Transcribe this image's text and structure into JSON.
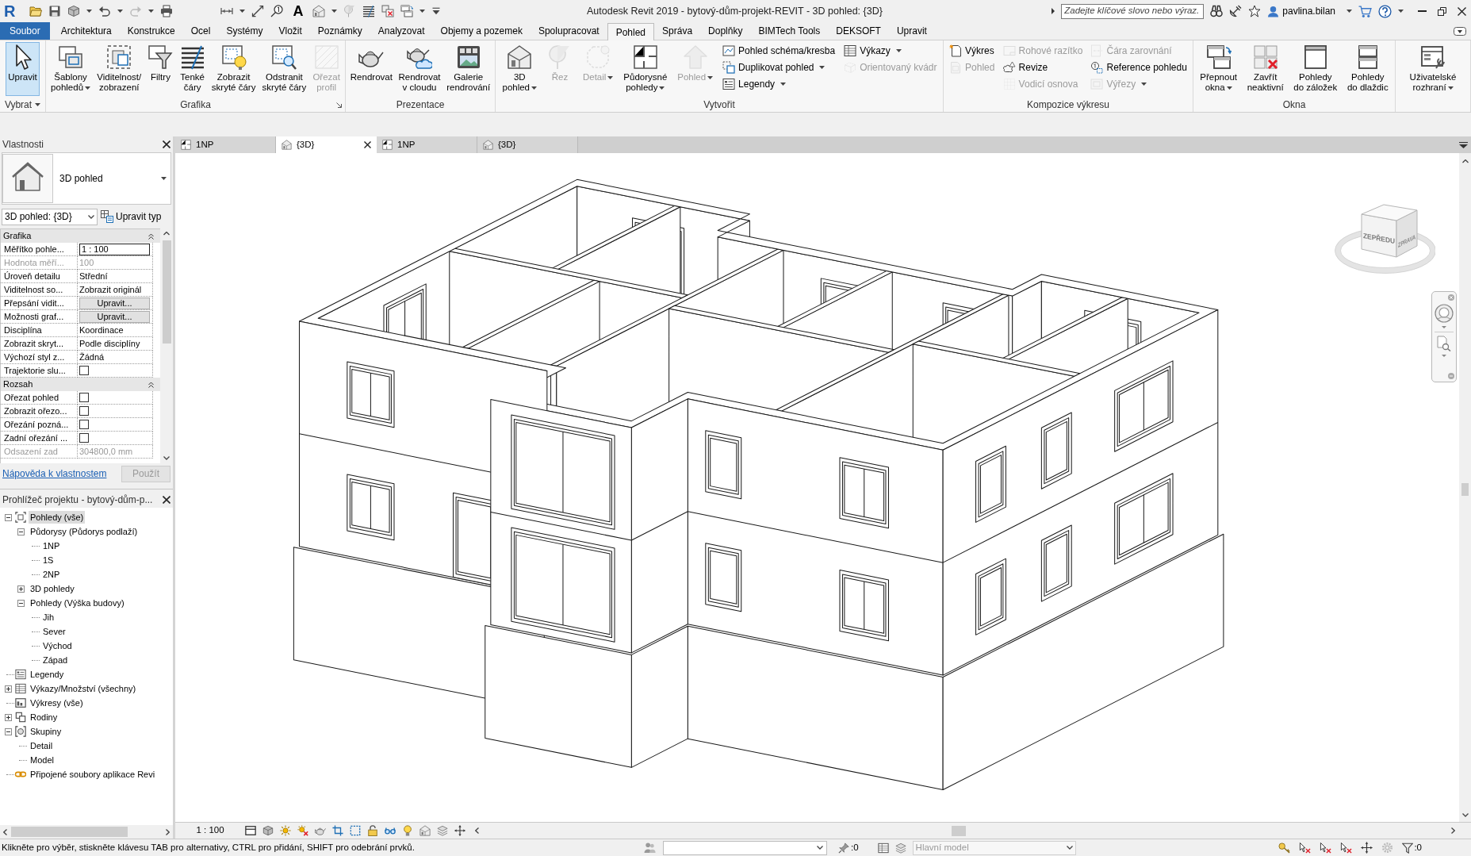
{
  "window": {
    "logo": "R",
    "title": "Autodesk Revit 2019 - bytový-dům-projekt-REVIT - 3D pohled: {3D}"
  },
  "quick_access": {
    "text_tool": "A"
  },
  "search": {
    "placeholder": "Zadejte klíčové slovo nebo výraz."
  },
  "user": {
    "name": "pavlina.bilan"
  },
  "ribbon_tabs": [
    {
      "label": "Soubor",
      "kind": "file",
      "selected": false
    },
    {
      "label": "Architektura",
      "kind": "tab",
      "selected": false
    },
    {
      "label": "Konstrukce",
      "kind": "tab",
      "selected": false
    },
    {
      "label": "Ocel",
      "kind": "tab",
      "selected": false
    },
    {
      "label": "Systémy",
      "kind": "tab",
      "selected": false
    },
    {
      "label": "Vložit",
      "kind": "tab",
      "selected": false
    },
    {
      "label": "Poznámky",
      "kind": "tab",
      "selected": false
    },
    {
      "label": "Analyzovat",
      "kind": "tab",
      "selected": false
    },
    {
      "label": "Objemy a pozemek",
      "kind": "tab",
      "selected": false
    },
    {
      "label": "Spolupracovat",
      "kind": "tab",
      "selected": false
    },
    {
      "label": "Pohled",
      "kind": "tab",
      "selected": true
    },
    {
      "label": "Správa",
      "kind": "tab",
      "selected": false
    },
    {
      "label": "Doplňky",
      "kind": "tab",
      "selected": false
    },
    {
      "label": "BIMTech Tools",
      "kind": "tab",
      "selected": false
    },
    {
      "label": "DEKSOFT",
      "kind": "tab",
      "selected": false
    },
    {
      "label": "Upravit",
      "kind": "tab",
      "selected": false
    }
  ],
  "ribbon_panels": [
    {
      "title": "Vybrat",
      "menu": true,
      "items": [
        {
          "kind": "large",
          "label": "Upravit",
          "active": true,
          "disabled": false
        }
      ]
    },
    {
      "title": "Grafika",
      "launcher": true,
      "items": [
        {
          "kind": "large",
          "label": "Šablony\npohledů",
          "dropdown": true,
          "disabled": false
        },
        {
          "kind": "large",
          "label": "Viditelnost/\nzobrazení",
          "disabled": false
        },
        {
          "kind": "large",
          "label": "Filtry",
          "disabled": false
        },
        {
          "kind": "large",
          "label": "Tenké\nčáry",
          "disabled": false
        },
        {
          "kind": "large",
          "label": "Zobrazit\nskryté čáry",
          "disabled": false
        },
        {
          "kind": "large",
          "label": "Odstranit\nskryté čáry",
          "disabled": false
        },
        {
          "kind": "large",
          "label": "Ořezat\nprofil",
          "disabled": true
        }
      ]
    },
    {
      "title": "Prezentace",
      "items": [
        {
          "kind": "large",
          "label": "Rendrovat",
          "disabled": false
        },
        {
          "kind": "large",
          "label": "Rendrovat\nv cloudu",
          "disabled": false
        },
        {
          "kind": "large",
          "label": "Galerie\nrendrování",
          "disabled": false
        }
      ]
    },
    {
      "title": "Vytvořit",
      "items": [
        {
          "kind": "large",
          "label": "3D\npohled",
          "dropdown": true,
          "disabled": false
        },
        {
          "kind": "large",
          "label": "Řez",
          "disabled": true
        },
        {
          "kind": "large",
          "label": "Detail",
          "dropdown": true,
          "disabled": true
        },
        {
          "kind": "large",
          "label": "Půdorysné\npohledy",
          "dropdown": true,
          "disabled": false
        },
        {
          "kind": "large",
          "label": "Pohled",
          "dropdown": true,
          "disabled": true
        },
        {
          "kind": "stack",
          "tools": [
            {
              "label": "Pohled schéma/kresba",
              "disabled": false
            },
            {
              "label": "Duplikovat pohled",
              "dropdown": true,
              "disabled": false
            },
            {
              "label": "Legendy",
              "dropdown": true,
              "disabled": false
            }
          ]
        },
        {
          "kind": "stack",
          "tools": [
            {
              "label": "Výkazy",
              "dropdown": true,
              "disabled": false
            },
            {
              "label": "Orientovaný kvádr",
              "disabled": true
            }
          ]
        }
      ]
    },
    {
      "title": "Kompozice výkresu",
      "items": [
        {
          "kind": "stack",
          "tools": [
            {
              "label": "Výkres",
              "disabled": false
            },
            {
              "label": "Pohled",
              "disabled": true
            }
          ]
        },
        {
          "kind": "stack",
          "tools": [
            {
              "label": "Rohové razítko",
              "disabled": true
            },
            {
              "label": "Revize",
              "disabled": false
            },
            {
              "label": "Vodicí osnova",
              "disabled": true
            }
          ]
        },
        {
          "kind": "stack",
          "tools": [
            {
              "label": "Čára zarovnání",
              "disabled": true
            },
            {
              "label": "Reference pohledu",
              "disabled": false
            },
            {
              "label": "Výřezy",
              "dropdown": true,
              "disabled": true
            }
          ]
        }
      ]
    },
    {
      "title": "Okna",
      "items": [
        {
          "kind": "large",
          "label": "Přepnout\nokna",
          "dropdown": true,
          "disabled": false
        },
        {
          "kind": "large",
          "label": "Zavřít\nneaktivní",
          "disabled": false
        },
        {
          "kind": "large",
          "label": "Pohledy\ndo záložek",
          "disabled": false
        },
        {
          "kind": "large",
          "label": "Pohledy\ndo dlaždic",
          "disabled": false
        }
      ]
    },
    {
      "items": [
        {
          "kind": "large",
          "label": "Uživatelské\nrozhraní",
          "dropdown": true,
          "disabled": false
        }
      ]
    }
  ],
  "view_tabs": [
    {
      "label": "1NP",
      "kind": "plan",
      "selected": false
    },
    {
      "label": "{3D}",
      "kind": "model",
      "selected": true
    },
    {
      "label": "1NP",
      "kind": "plan",
      "selected": false
    },
    {
      "label": "{3D}",
      "kind": "model",
      "selected": false
    }
  ],
  "properties": {
    "title": "Vlastnosti",
    "type_name": "3D pohled",
    "instance": "3D pohled: {3D}",
    "edit_type": "Upravit typ",
    "groups": [
      {
        "title": "Grafika",
        "expanded": true,
        "rows": [
          {
            "name": "Měřítko pohle...",
            "kind": "input",
            "value": "1 : 100",
            "disabled": false
          },
          {
            "name": "Hodnota měří...",
            "kind": "text",
            "value": "100",
            "disabled": true
          },
          {
            "name": "Úroveň detailu",
            "kind": "text",
            "value": "Střední",
            "disabled": false
          },
          {
            "name": "Viditelnost so...",
            "kind": "text",
            "value": "Zobrazit originál",
            "disabled": false
          },
          {
            "name": "Přepsání vidit...",
            "kind": "button",
            "value": "Upravit...",
            "disabled": false
          },
          {
            "name": "Možnosti graf...",
            "kind": "button",
            "value": "Upravit...",
            "disabled": false
          },
          {
            "name": "Disciplína",
            "kind": "text",
            "value": "Koordinace",
            "disabled": false
          },
          {
            "name": "Zobrazit skryt...",
            "kind": "text",
            "value": "Podle disciplíny",
            "disabled": false
          },
          {
            "name": "Výchozí styl z...",
            "kind": "text",
            "value": "Žádná",
            "disabled": false
          },
          {
            "name": "Trajektorie slu...",
            "kind": "checkbox",
            "checked": false,
            "disabled": false
          }
        ]
      },
      {
        "title": "Rozsah",
        "expanded": true,
        "rows": [
          {
            "name": "Ořezat pohled",
            "kind": "checkbox",
            "checked": false,
            "disabled": false
          },
          {
            "name": "Zobrazit ořezo...",
            "kind": "checkbox",
            "checked": false,
            "disabled": false
          },
          {
            "name": "Ořezání pozná...",
            "kind": "checkbox",
            "checked": false,
            "disabled": false
          },
          {
            "name": "Zadní ořezání ...",
            "kind": "checkbox",
            "checked": false,
            "disabled": false
          },
          {
            "name": "Odsazení zad",
            "kind": "text",
            "value": "304800,0 mm",
            "disabled": true
          }
        ]
      }
    ],
    "help_link": "Nápověda k vlastnostem",
    "apply": {
      "label": "Použít",
      "disabled": true
    }
  },
  "project_browser": {
    "title": "Prohlížeč projektu - bytový-dům-p...",
    "tree": [
      {
        "label": "Pohledy (vše)",
        "kind": "views",
        "selected": true,
        "expanded": true,
        "children": [
          {
            "label": "Půdorysy (Půdorys podlaží)",
            "selected": false,
            "expanded": true,
            "children": [
              {
                "label": "1NP",
                "selected": false
              },
              {
                "label": "1S",
                "selected": false
              },
              {
                "label": "2NP",
                "selected": false
              }
            ]
          },
          {
            "label": "3D pohledy",
            "selected": false,
            "expanded": false
          },
          {
            "label": "Pohledy (Výška budovy)",
            "selected": false,
            "expanded": true,
            "children": [
              {
                "label": "Jih",
                "selected": false
              },
              {
                "label": "Sever",
                "selected": false
              },
              {
                "label": "Východ",
                "selected": false
              },
              {
                "label": "Západ",
                "selected": false
              }
            ]
          }
        ]
      },
      {
        "label": "Legendy",
        "kind": "legends",
        "selected": false
      },
      {
        "label": "Výkazy/Množství (všechny)",
        "kind": "schedules",
        "selected": false,
        "expanded": false
      },
      {
        "label": "Výkresy (vše)",
        "kind": "sheets",
        "selected": false
      },
      {
        "label": "Rodiny",
        "kind": "families",
        "selected": false,
        "expanded": false
      },
      {
        "label": "Skupiny",
        "kind": "groups",
        "selected": false,
        "expanded": true,
        "children": [
          {
            "label": "Detail",
            "selected": false
          },
          {
            "label": "Model",
            "selected": false
          }
        ]
      },
      {
        "label": "Připojené soubory aplikace Revi",
        "kind": "links",
        "selected": false
      }
    ]
  },
  "view_cube": {
    "front": "ZEPŘEDU",
    "right": "ZPRAVA"
  },
  "view_control_bar": {
    "scale": "1 : 100"
  },
  "status_bar": {
    "message": "Klikněte pro výběr, stiskněte klávesu TAB pro alternativy, CTRL pro přidání, SHIFT pro odebrání prvků.",
    "editing_count": ":0",
    "design_option": {
      "value": "Hlavní model",
      "disabled": true
    },
    "filter_count": ":0"
  }
}
